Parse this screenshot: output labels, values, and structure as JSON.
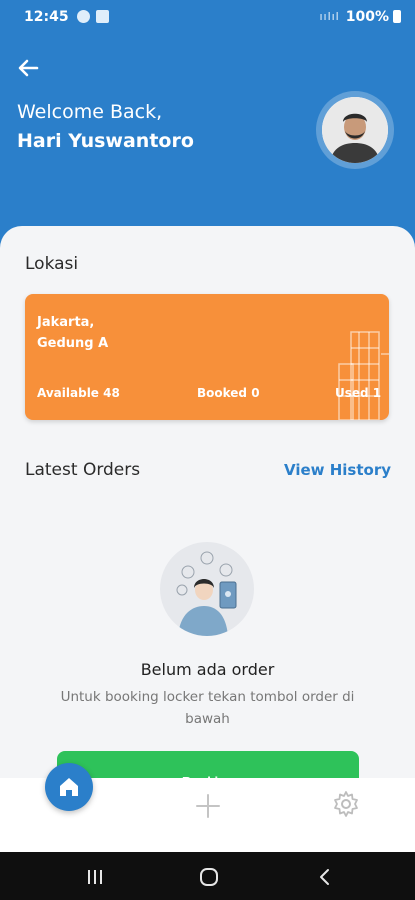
{
  "status_bar": {
    "time": "12:45",
    "signal": "ıılıl",
    "battery_percent": "100%"
  },
  "header": {
    "welcome": "Welcome Back,",
    "user_name": "Hari Yuswantoro"
  },
  "location": {
    "title": "Lokasi",
    "city": "Jakarta,",
    "building": "Gedung A",
    "available": "Available 48",
    "booked": "Booked 0",
    "used": "Used 1",
    "card_color": "#f7903a"
  },
  "orders": {
    "title": "Latest Orders",
    "view_history": "View History",
    "empty_title": "Belum ada order",
    "empty_desc": "Untuk booking locker tekan tombol order di bawah",
    "booking_button": "Booking"
  },
  "bottom_nav": {
    "items": [
      {
        "icon": "home-icon"
      },
      {
        "icon": "plus-icon"
      },
      {
        "icon": "gear-icon"
      }
    ]
  },
  "colors": {
    "primary": "#2b7fca",
    "success": "#2ec25a",
    "accent": "#f7903a"
  }
}
